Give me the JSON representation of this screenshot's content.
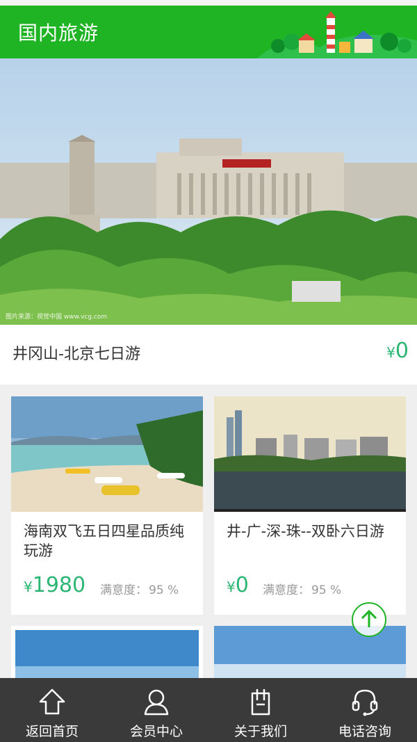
{
  "header": {
    "title": "国内旅游"
  },
  "hero": {
    "caption": "图片来源：视觉中国 www.vcg.com",
    "name": "井冈山-北京七日游",
    "currency": "¥",
    "price": "0"
  },
  "cards": [
    {
      "title": "海南双飞五日四星品质纯玩游",
      "currency": "¥",
      "price": "1980",
      "sat_label": "满意度：",
      "sat_value": "95 %"
    },
    {
      "title": "井-广-深-珠--双卧六日游",
      "currency": "¥",
      "price": "0",
      "sat_label": "满意度：",
      "sat_value": "95 %"
    }
  ],
  "tabbar": {
    "items": [
      {
        "label": "返回首页",
        "icon": "home-icon"
      },
      {
        "label": "会员中心",
        "icon": "user-icon"
      },
      {
        "label": "关于我们",
        "icon": "info-icon"
      },
      {
        "label": "电话咨询",
        "icon": "headset-icon"
      }
    ]
  },
  "colors": {
    "brand_green": "#1fb424",
    "price_green": "#2bb673",
    "tabbar_bg": "#3a3a3a"
  }
}
